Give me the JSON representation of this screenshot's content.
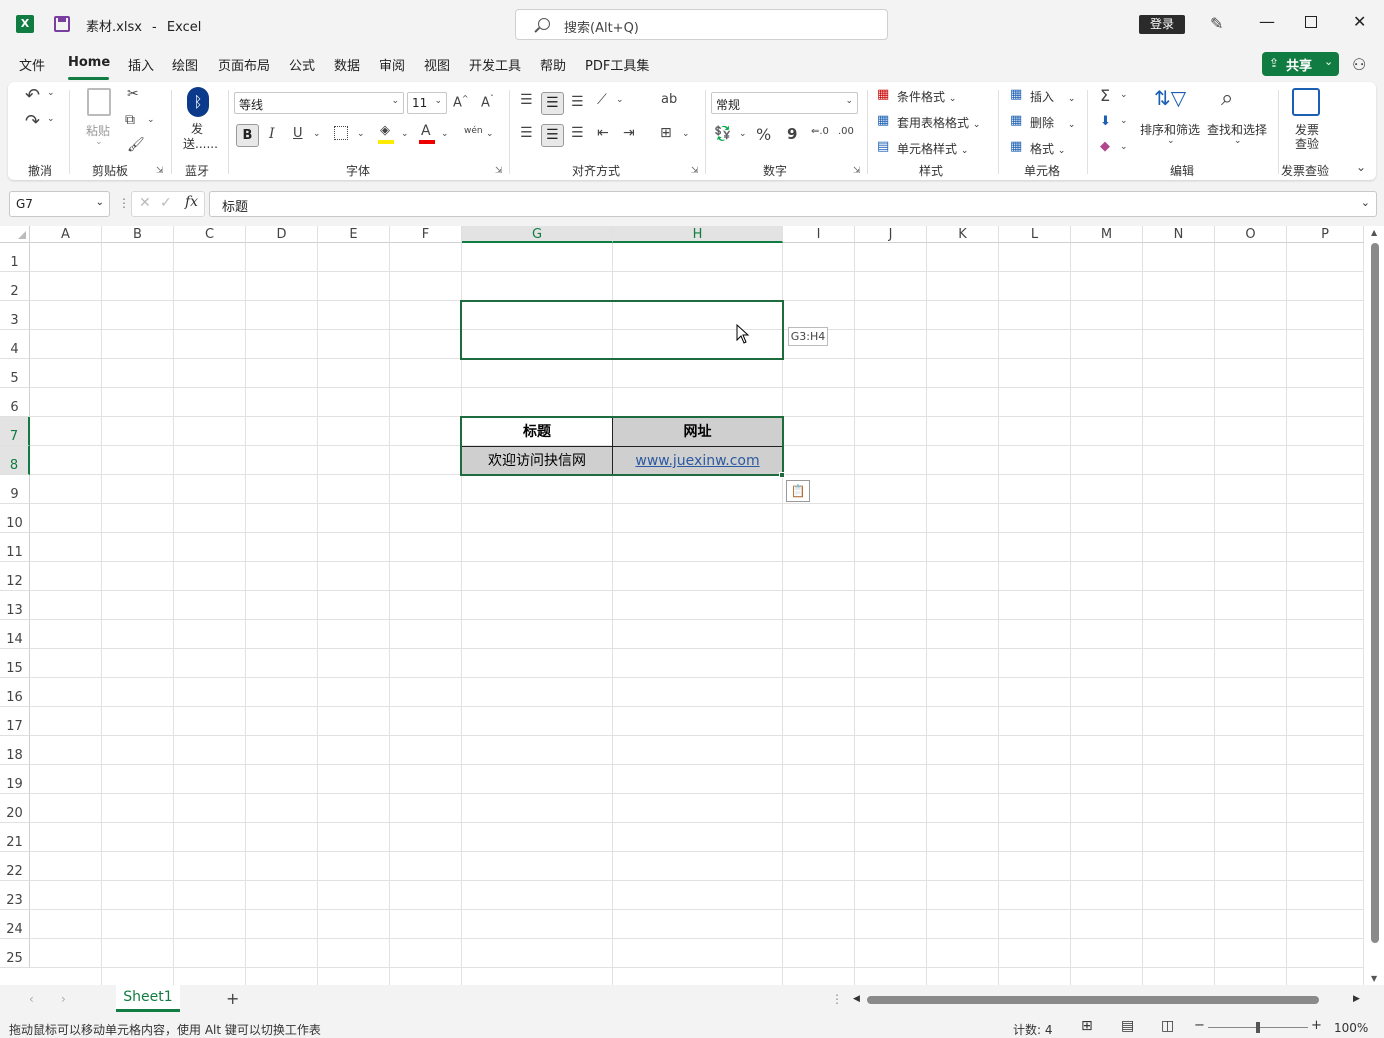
{
  "window": {
    "filename": "素材.xlsx",
    "app": "Excel",
    "title_sep": "-",
    "search_placeholder": "搜索(Alt+Q)",
    "login": "登录",
    "excel_icon": "X"
  },
  "menu": {
    "tabs": [
      "文件",
      "Home",
      "插入",
      "绘图",
      "页面布局",
      "公式",
      "数据",
      "审阅",
      "视图",
      "开发工具",
      "帮助",
      "PDF工具集"
    ],
    "active": "Home",
    "share": "共享"
  },
  "ribbon": {
    "groups": {
      "undo": "撤消",
      "clipboard": "剪贴板",
      "bluetooth": "蓝牙",
      "font": "字体",
      "alignment": "对齐方式",
      "number": "数字",
      "styles": "样式",
      "cells": "单元格",
      "editing": "编辑",
      "invoice": "发票查验"
    },
    "paste": "粘贴",
    "send_line1": "发",
    "send_line2": "送......",
    "font_name": "等线",
    "font_size": "11",
    "number_format": "常规",
    "conditional_format": "条件格式",
    "table_format": "套用表格格式",
    "cell_styles": "单元格样式",
    "insert": "插入",
    "delete": "删除",
    "format": "格式",
    "sort_filter": "排序和筛选",
    "find_select": "查找和选择",
    "invoice_line1": "发票",
    "invoice_line2": "查验",
    "bold": "B",
    "italic": "I",
    "underline": "U",
    "percent": "%",
    "comma": "9",
    "phonetic": "wén"
  },
  "formula_bar": {
    "name_box": "G7",
    "fx": "fx",
    "content": "标题"
  },
  "grid": {
    "columns": [
      "A",
      "B",
      "C",
      "D",
      "E",
      "F",
      "G",
      "H",
      "I",
      "J",
      "K",
      "L",
      "M",
      "N",
      "O",
      "P"
    ],
    "rows": [
      "1",
      "2",
      "3",
      "4",
      "5",
      "6",
      "7",
      "8",
      "9",
      "10",
      "11",
      "12",
      "13",
      "14",
      "15",
      "16",
      "17",
      "18",
      "19",
      "20",
      "21",
      "22",
      "23",
      "24",
      "25"
    ],
    "cells": {
      "G7": "标题",
      "H7": "网址",
      "G8": "欢迎访问抉信网",
      "H8": "www.juexinw.com"
    },
    "drag_tooltip": "G3:H4"
  },
  "sheets": {
    "tabs": [
      "Sheet1"
    ],
    "add": "+"
  },
  "status": {
    "message": "拖动鼠标可以移动单元格内容，使用 Alt 键可以切换工作表",
    "count": "计数: 4",
    "zoom": "100%",
    "zoom_level": 1.0
  },
  "colors": {
    "accent": "#107c41",
    "selection": "#1e6b3e",
    "header_fill": "#cfcfcf",
    "link": "#2c5aa0"
  }
}
